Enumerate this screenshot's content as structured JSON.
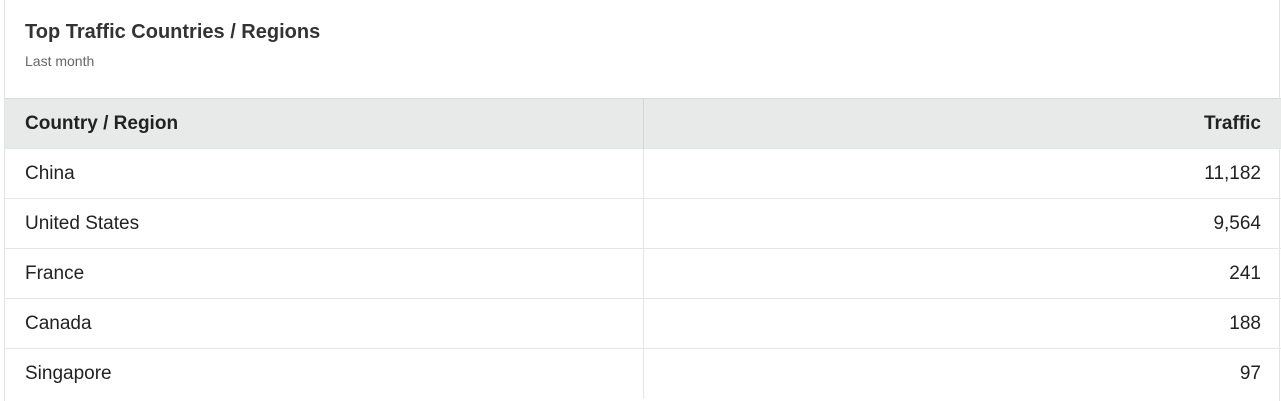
{
  "card": {
    "title": "Top Traffic Countries / Regions",
    "subtitle": "Last month"
  },
  "table": {
    "headers": {
      "country": "Country / Region",
      "traffic": "Traffic"
    },
    "rows": [
      {
        "country": "China",
        "traffic": "11,182"
      },
      {
        "country": "United States",
        "traffic": "9,564"
      },
      {
        "country": "France",
        "traffic": "241"
      },
      {
        "country": "Canada",
        "traffic": "188"
      },
      {
        "country": "Singapore",
        "traffic": "97"
      }
    ]
  }
}
